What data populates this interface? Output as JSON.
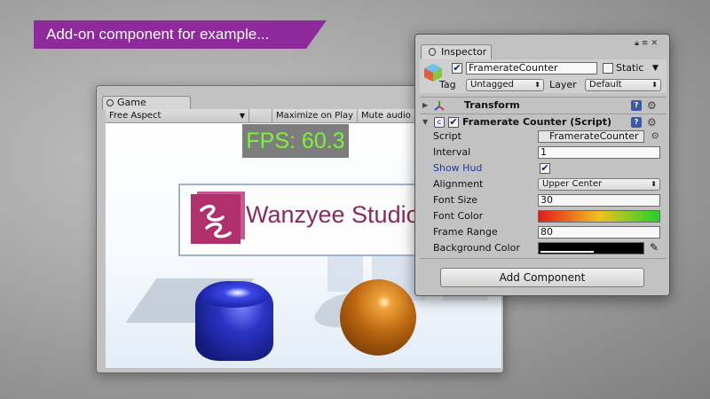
{
  "banner": {
    "text": "Add-on component for example..."
  },
  "game_window": {
    "tab_label": "Game",
    "toolbar": {
      "aspect_label": "Free Aspect",
      "maximize_label": "Maximize on Play",
      "mute_label": "Mute audio"
    },
    "fps_text": "FPS: 60.3",
    "logo_text": "Wanzyee Studio"
  },
  "inspector": {
    "tab_label": "Inspector",
    "object": {
      "active": true,
      "name": "FramerateCounter",
      "static_label": "Static",
      "static_checked": false,
      "tag_label": "Tag",
      "tag_value": "Untagged",
      "layer_label": "Layer",
      "layer_value": "Default"
    },
    "components": {
      "transform": {
        "title": "Transform"
      },
      "framerate_counter": {
        "enabled": true,
        "title": "Framerate Counter (Script)",
        "properties": {
          "script_label": "Script",
          "script_value": "FramerateCounter",
          "interval_label": "Interval",
          "interval_value": "1",
          "show_hud_label": "Show Hud",
          "show_hud_checked": true,
          "alignment_label": "Alignment",
          "alignment_value": "Upper Center",
          "font_size_label": "Font Size",
          "font_size_value": "30",
          "font_color_label": "Font Color",
          "frame_range_label": "Frame Range",
          "frame_range_value": "80",
          "background_color_label": "Background Color"
        }
      }
    },
    "add_component_label": "Add Component"
  },
  "colors": {
    "banner_purple": "#8e2a9c",
    "fps_text_green": "#7cf23a",
    "fps_bg_gray": "#7d7d7d",
    "logo_magenta": "#8a2a5e",
    "font_color_gradient": [
      "#e11b1b",
      "#f0c020",
      "#22d12a"
    ],
    "background_color_swatch": "#000000",
    "show_hud_blue": "#1f3aa8"
  }
}
